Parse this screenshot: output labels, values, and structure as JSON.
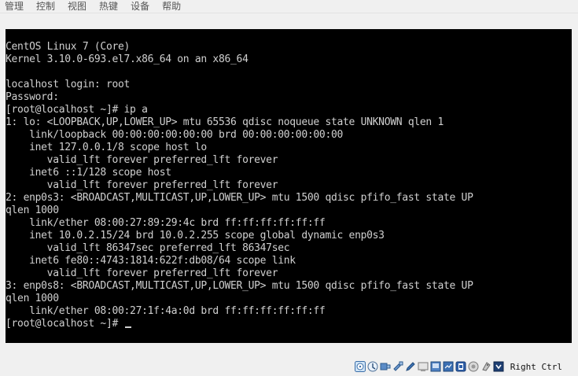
{
  "menubar": {
    "items": [
      {
        "label": "管理"
      },
      {
        "label": "控制"
      },
      {
        "label": "视图"
      },
      {
        "label": "热键"
      },
      {
        "label": "设备"
      },
      {
        "label": "帮助"
      }
    ]
  },
  "console": {
    "lines": [
      "CentOS Linux 7 (Core)",
      "Kernel 3.10.0-693.el7.x86_64 on an x86_64",
      "",
      "localhost login: root",
      "Password:",
      "[root@localhost ~]# ip a",
      "1: lo: <LOOPBACK,UP,LOWER_UP> mtu 65536 qdisc noqueue state UNKNOWN qlen 1",
      "    link/loopback 00:00:00:00:00:00 brd 00:00:00:00:00:00",
      "    inet 127.0.0.1/8 scope host lo",
      "       valid_lft forever preferred_lft forever",
      "    inet6 ::1/128 scope host",
      "       valid_lft forever preferred_lft forever",
      "2: enp0s3: <BROADCAST,MULTICAST,UP,LOWER_UP> mtu 1500 qdisc pfifo_fast state UP",
      "qlen 1000",
      "    link/ether 08:00:27:89:29:4c brd ff:ff:ff:ff:ff:ff",
      "    inet 10.0.2.15/24 brd 10.0.2.255 scope global dynamic enp0s3",
      "       valid_lft 86347sec preferred_lft 86347sec",
      "    inet6 fe80::4743:1814:622f:db08/64 scope link",
      "       valid_lft forever preferred_lft forever",
      "3: enp0s8: <BROADCAST,MULTICAST,UP,LOWER_UP> mtu 1500 qdisc pfifo_fast state UP",
      "qlen 1000",
      "    link/ether 08:00:27:1f:4a:0d brd ff:ff:ff:ff:ff:ff"
    ],
    "prompt": "[root@localhost ~]# "
  },
  "statusbar": {
    "icons": [
      "optical-drive-icon",
      "network-activity-icon",
      "usb-icon",
      "shared-folder-icon",
      "pen-icon",
      "display-icon",
      "screen-capture-icon",
      "network-adapter-icon",
      "recording-icon",
      "cpu-icon",
      "mouse-integration-icon",
      "keyboard-capture-icon"
    ],
    "host_key_label": "Right Ctrl"
  },
  "colors": {
    "console_bg": "#000000",
    "console_fg": "#d0d0d0",
    "chrome_bg": "#f0f0f0"
  }
}
